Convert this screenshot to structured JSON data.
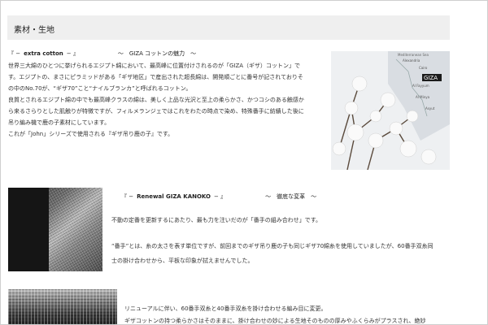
{
  "section": {
    "title": "素材・生地"
  },
  "giza": {
    "heading_open": "『 −",
    "heading_strong": "extra cotton",
    "heading_close": "− 』",
    "subheading": "〜　GIZA コットンの魅力　〜",
    "lines": [
      "世界三大綿のひとつに挙げられるエジプト綿において、最高峰に位置付けされるのが「GIZA（ギザ）コットン」で",
      "す。エジプトの、まさにピラミッドがある「ギザ地区」で産出された超長綿は、開発順ごとに番号が記されておりそ",
      "の中のNo.70が、“ギザ70”こと“ナイルブランカ”と呼ばれるコットン。",
      "良質とされるエジプト綿の中でも最高峰クラスの綿は、美しく上品な光沢と至上の柔らかさ、かつコシのある触感か",
      "ら来るさらりとした肌触りが特徴ですが、フィルメランジェではこれをわたの時点で染め、特殊番手に紡績した後に",
      "吊り編み機で鹿の子素材にしています。",
      "これが「John」シリーズで使用される『ギザ吊り鹿の子』です。"
    ]
  },
  "map": {
    "label_region": "Mediterranean Sea",
    "label_city1": "Alexandria",
    "label_city2": "Cairo",
    "label_giza": "GIZA",
    "label_city3": "Al Fayyum",
    "label_city4": "Al Minya",
    "label_city5": "Asyut"
  },
  "kanoko": {
    "heading_open": "『 −",
    "heading_strong": "Renewal GIZA KANOKO",
    "heading_close": "− 』",
    "subheading": "〜　徹底な変革　〜",
    "lines": [
      "不動の定番を更新するにあたり、最も力を注いだのが「番手の組み合わせ」です。",
      "",
      "“番手”とは、糸の太さを表す単位ですが、前回までのギザ吊り鹿の子も同じギザ70綿糸を使用していましたが、60番手双糸同",
      "士の掛け合わせから、平板な印象が拭えませんでした。"
    ]
  },
  "renewal": {
    "lines": [
      "リニューアルに伴い、60番手双糸と40番手双糸を掛け合わせる編み目に変更。",
      "ギザコットンの持つ柔らかさはそのままに、掛け合わせの妙による生地そのものの厚みやふくらみがプラスされ、絶妙"
    ]
  },
  "colors": {
    "header_bg": "#efefef",
    "border": "#cfcfcf",
    "text": "#333333"
  }
}
